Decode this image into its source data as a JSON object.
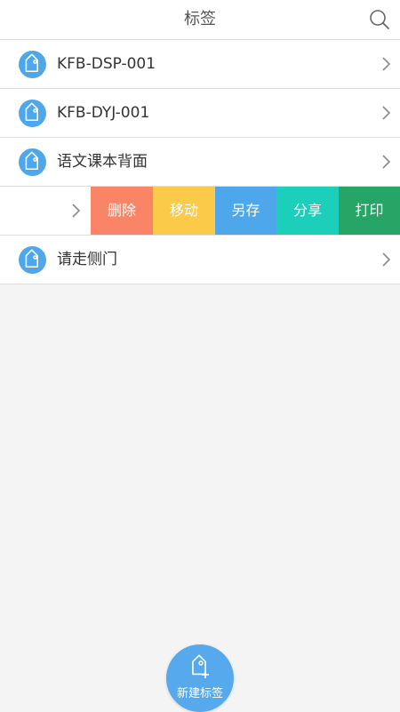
{
  "header": {
    "title": "标签",
    "search_icon": "search-icon"
  },
  "tags": [
    {
      "label": "KFB-DSP-001"
    },
    {
      "label": "KFB-DYJ-001"
    },
    {
      "label": "语文课本背面"
    },
    {
      "label": ""
    },
    {
      "label": "请走侧门"
    }
  ],
  "swipe_actions": [
    {
      "label": "删除",
      "color": "#f98566"
    },
    {
      "label": "移动",
      "color": "#fcca49"
    },
    {
      "label": "另存",
      "color": "#4ea7ea"
    },
    {
      "label": "分享",
      "color": "#1ccfbb"
    },
    {
      "label": "打印",
      "color": "#26a566"
    }
  ],
  "fab": {
    "label": "新建标签",
    "icon": "add-tag-icon"
  },
  "colors": {
    "accent": "#4ea7ea",
    "background": "#f4f4f4"
  }
}
